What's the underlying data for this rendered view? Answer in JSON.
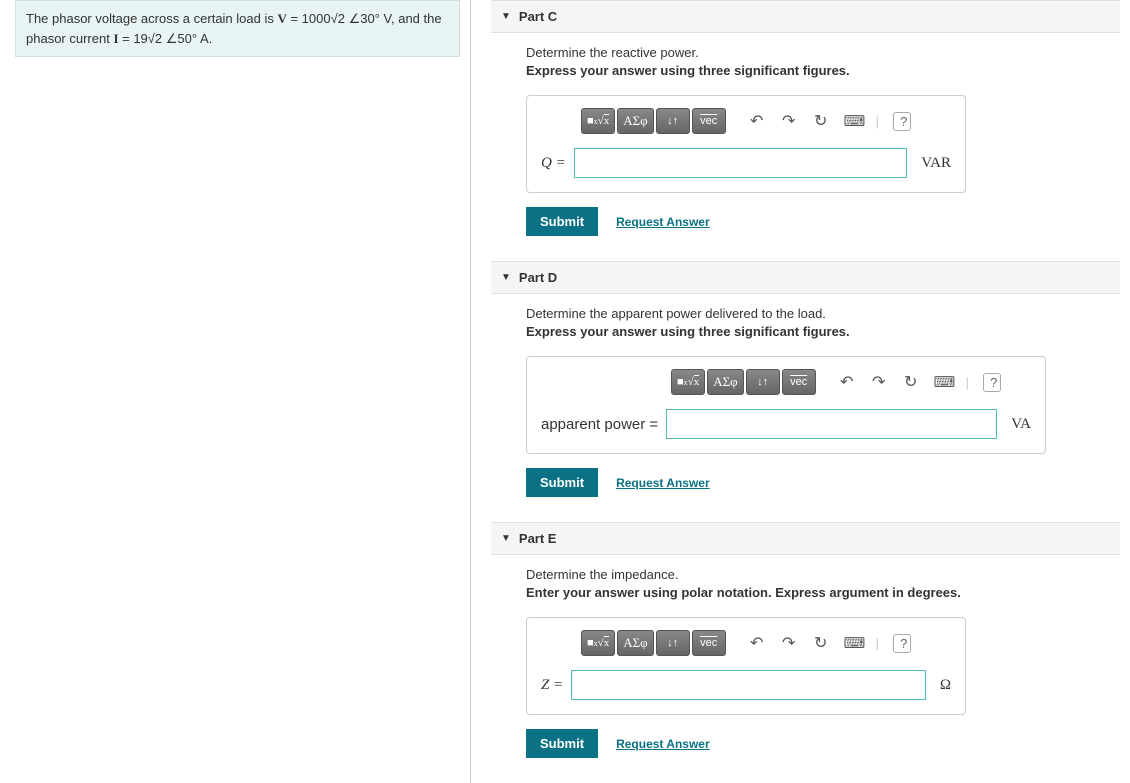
{
  "problem": {
    "text_prefix": "The phasor voltage across a certain load is ",
    "v_symbol": "V",
    "v_value": " = 1000√2 ∠30° V",
    "text_mid": ", and the phasor current ",
    "i_symbol": "I",
    "i_value": " = 19√2 ∠50° A",
    "text_suffix": "."
  },
  "toolbar": {
    "template_label": "x√x",
    "greek_label": "ΑΣφ",
    "arrows_label": "↓↑",
    "vec_label": "vec",
    "undo_icon": "↶",
    "redo_icon": "↷",
    "reset_icon": "↻",
    "keyboard_icon": "⌨",
    "help_icon": "?"
  },
  "buttons": {
    "submit": "Submit",
    "request_answer": "Request Answer"
  },
  "parts": {
    "c": {
      "title": "Part C",
      "prompt1": "Determine the reactive power.",
      "prompt2": "Express your answer using three significant figures.",
      "var_label": "Q =",
      "unit": "VAR"
    },
    "d": {
      "title": "Part D",
      "prompt1": "Determine the apparent power delivered to the load.",
      "prompt2": "Express your answer using three significant figures.",
      "var_label": "apparent power =",
      "unit": "VA"
    },
    "e": {
      "title": "Part E",
      "prompt1": "Determine the impedance.",
      "prompt2": "Enter your answer using polar notation. Express argument in degrees.",
      "var_label": "Z =",
      "unit": "Ω"
    }
  }
}
